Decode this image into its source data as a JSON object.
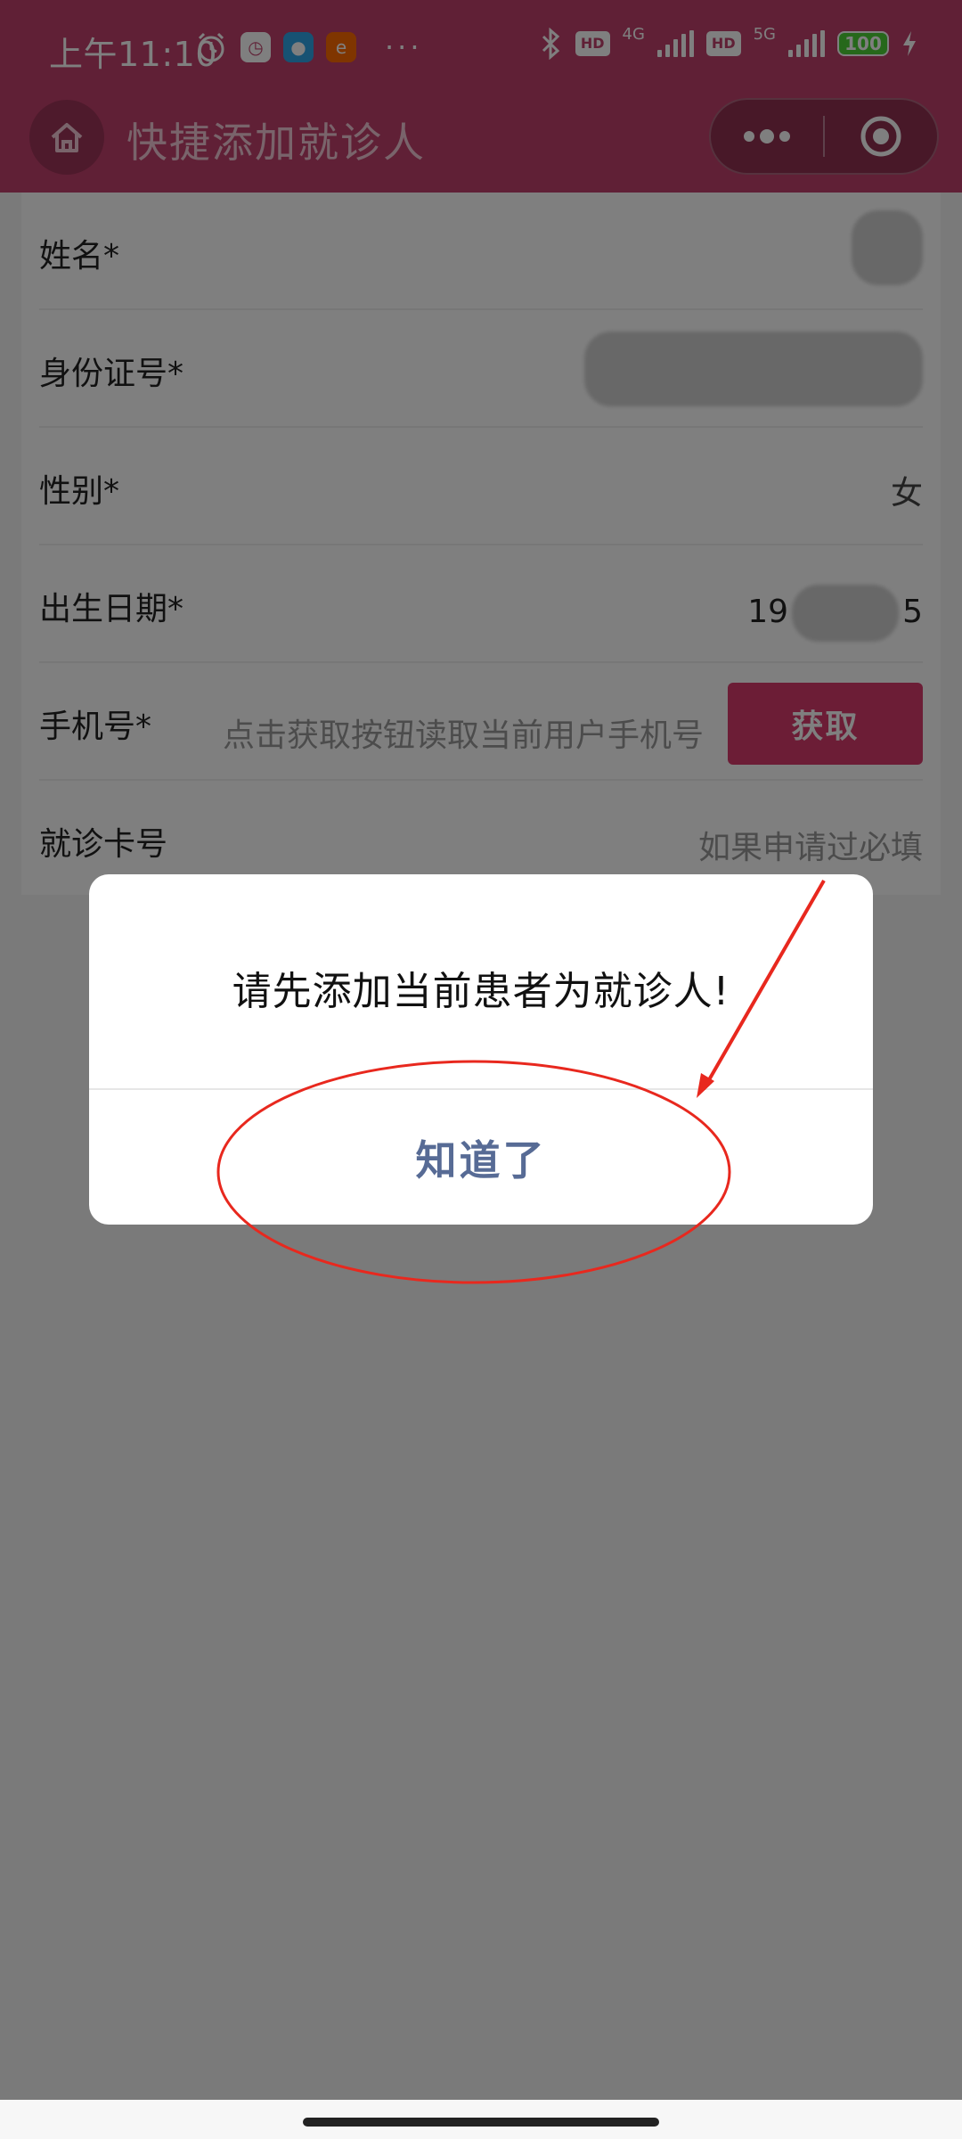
{
  "status_bar": {
    "time": "上午11:10",
    "network_4g": "4G",
    "network_5g": "5G",
    "hd": "HD",
    "battery": "100"
  },
  "header": {
    "title": "快捷添加就诊人"
  },
  "form": {
    "name_label": "姓名*",
    "id_label": "身份证号*",
    "gender_label": "性别*",
    "gender_value": "女",
    "birth_label": "出生日期*",
    "birth_value_prefix": "19",
    "birth_value_suffix": "5",
    "phone_label": "手机号*",
    "phone_placeholder": "点击获取按钮读取当前用户手机号",
    "phone_button": "获取",
    "card_label": "就诊卡号",
    "card_placeholder": "如果申请过必填"
  },
  "modal": {
    "message": "请先添加当前患者为就诊人!",
    "confirm": "知道了"
  },
  "colors": {
    "brand": "#c0406c",
    "button": "#d83a6c",
    "link": "#576b95",
    "annotation": "#e8281e"
  }
}
